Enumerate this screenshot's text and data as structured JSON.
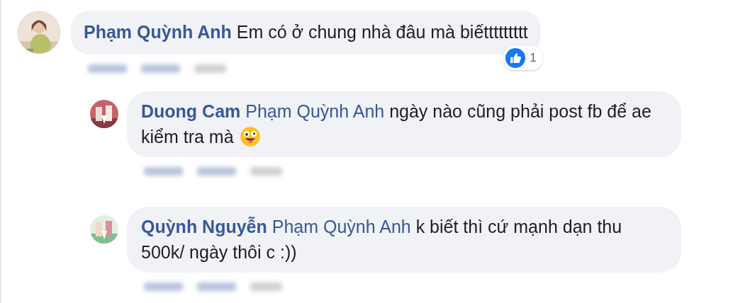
{
  "comments": [
    {
      "author": "Phạm Quỳnh Anh",
      "text": "Em có ở chung nhà đâu mà biếttttttttt",
      "reaction_count": "1",
      "replies": [
        {
          "author": "Duong Cam",
          "mention": "Phạm Quỳnh Anh",
          "text": "ngày nào cũng phải post fb để ae kiểm tra mà",
          "emoji": true
        },
        {
          "author": "Quỳnh Nguyễn",
          "mention": "Phạm Quỳnh Anh",
          "text": "k biết thì cứ mạnh dạn thu 500k/ ngày thôi c :))",
          "emoji": false
        }
      ]
    }
  ]
}
